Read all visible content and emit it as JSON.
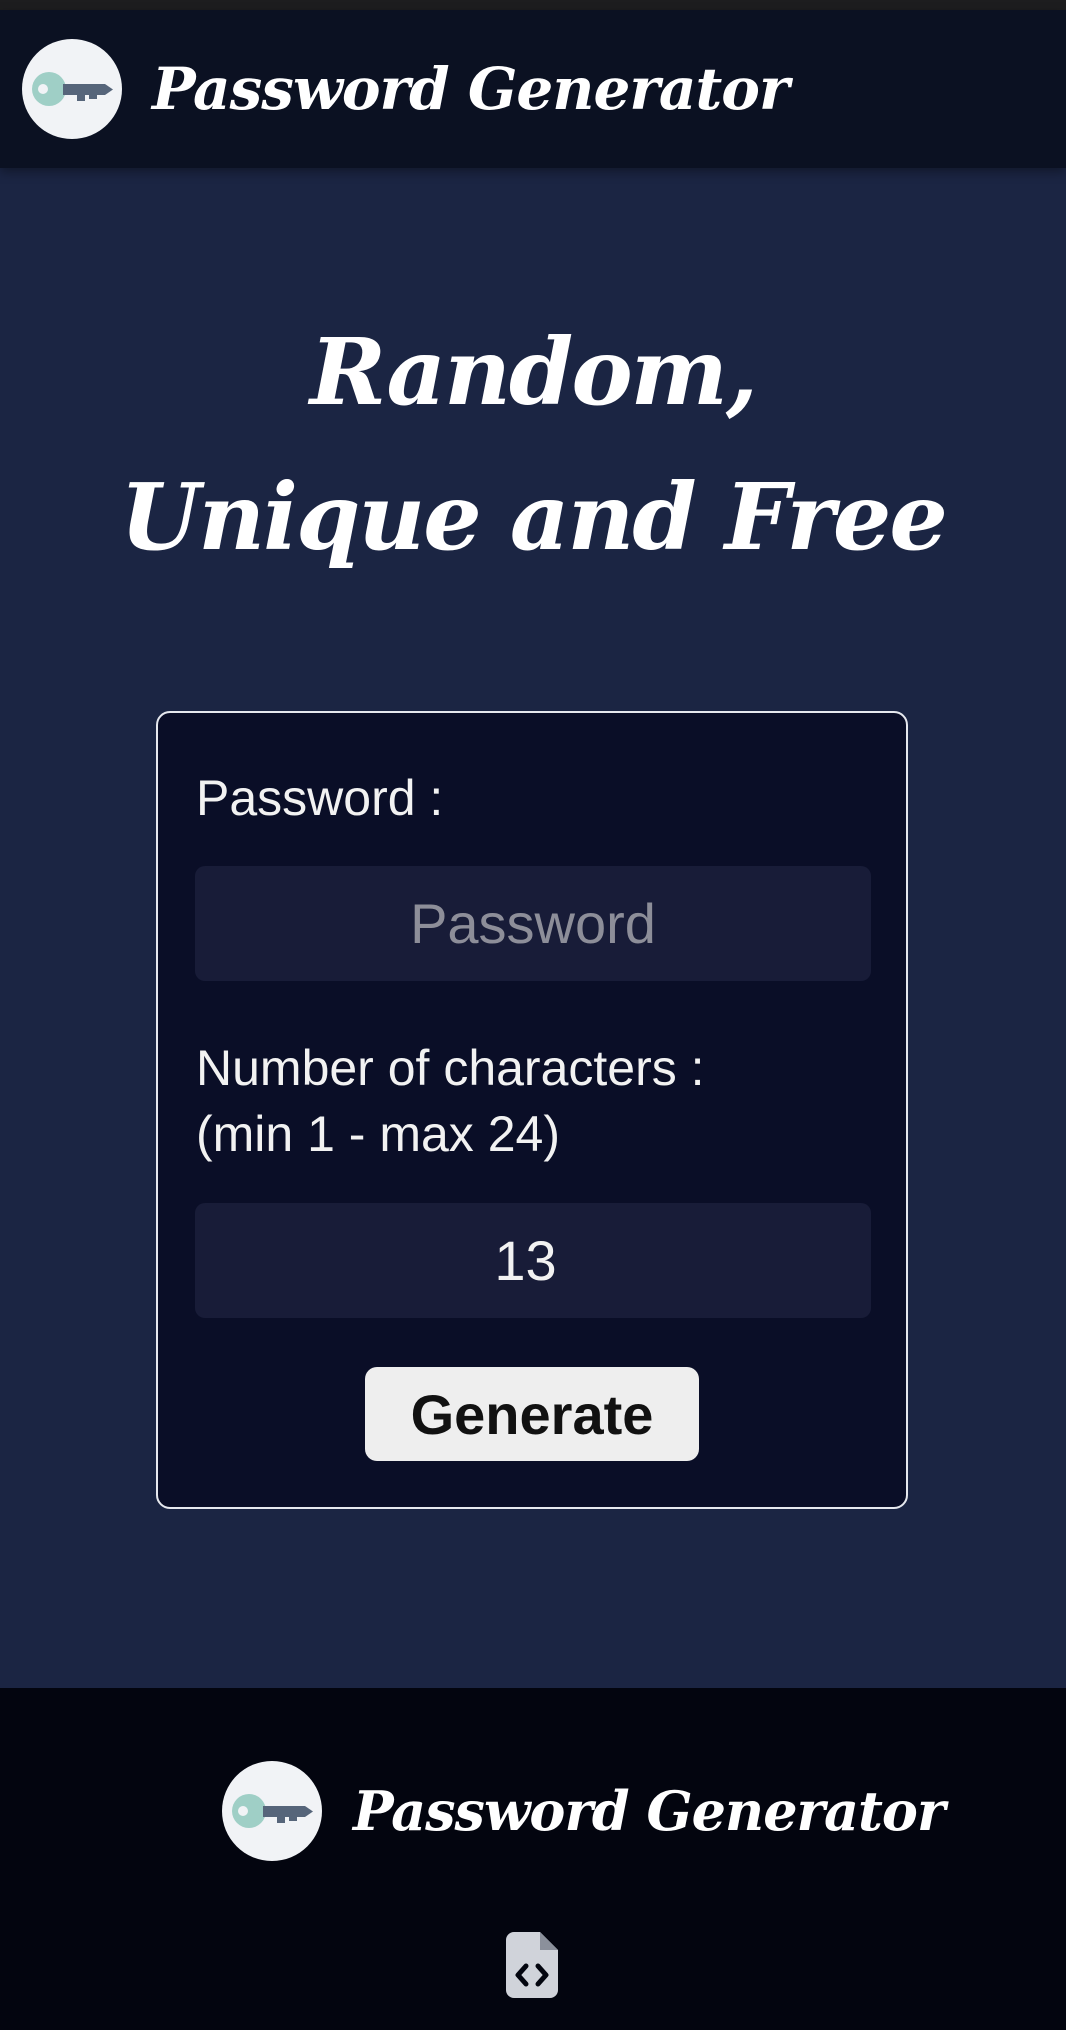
{
  "app": {
    "title": "Password Generator",
    "logo_icon": "key-icon"
  },
  "hero": {
    "line1": "Random,",
    "line2": "Unique and Free"
  },
  "form": {
    "password_label": "Password :",
    "password_placeholder": "Password",
    "password_value": "",
    "length_label_line1": "Number of characters :",
    "length_label_line2": "(min 1 - max 24)",
    "length_value": "13",
    "length_min": "1",
    "length_max": "24",
    "generate_label": "Generate"
  },
  "footer": {
    "brand": "Password Generator",
    "logo_icon": "key-icon",
    "source_icon": "code-file-icon"
  },
  "colors": {
    "background": "#1b2543",
    "header_bg": "#0b1122",
    "card_bg": "#0a0e27",
    "field_bg": "#181c38",
    "footer_bg": "#03050f",
    "key_teal": "#9fcfc6",
    "key_slate": "#56657a"
  }
}
